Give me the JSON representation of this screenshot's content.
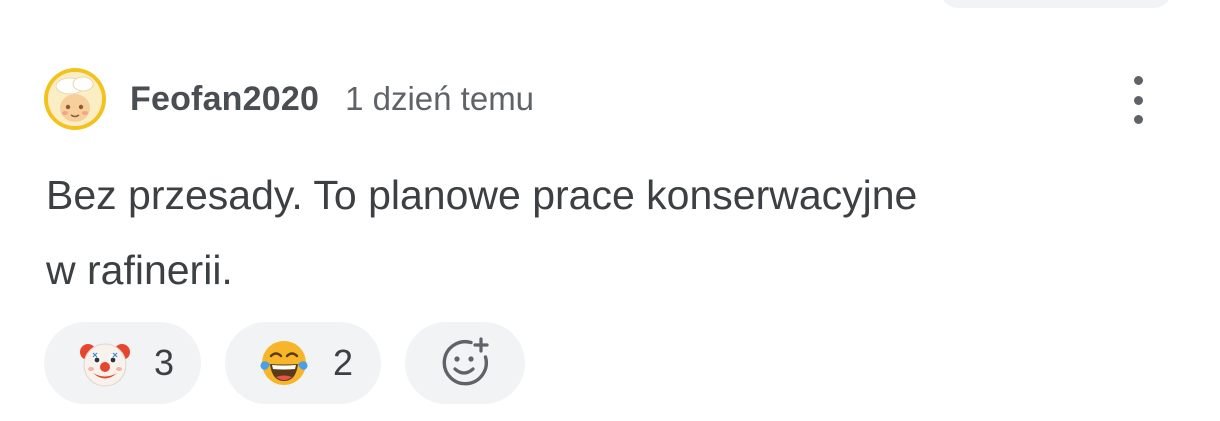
{
  "comment": {
    "author": "Feofan2020",
    "time": "1 dzień temu",
    "text_line1": "Bez przesady. To planowe prace konserwacyjne",
    "text_line2": "w rafinerii."
  },
  "reactions": [
    {
      "icon": "clown-face-icon",
      "count": "3"
    },
    {
      "icon": "laughing-tears-icon",
      "count": "2"
    }
  ],
  "add_reaction_icon": "add-emoji-icon",
  "more_icon": "more-vertical-icon",
  "colors": {
    "avatar_ring": "#f4c21c",
    "pill_background": "#f2f3f5",
    "text": "#3c4043",
    "muted_text": "#5f6368"
  }
}
